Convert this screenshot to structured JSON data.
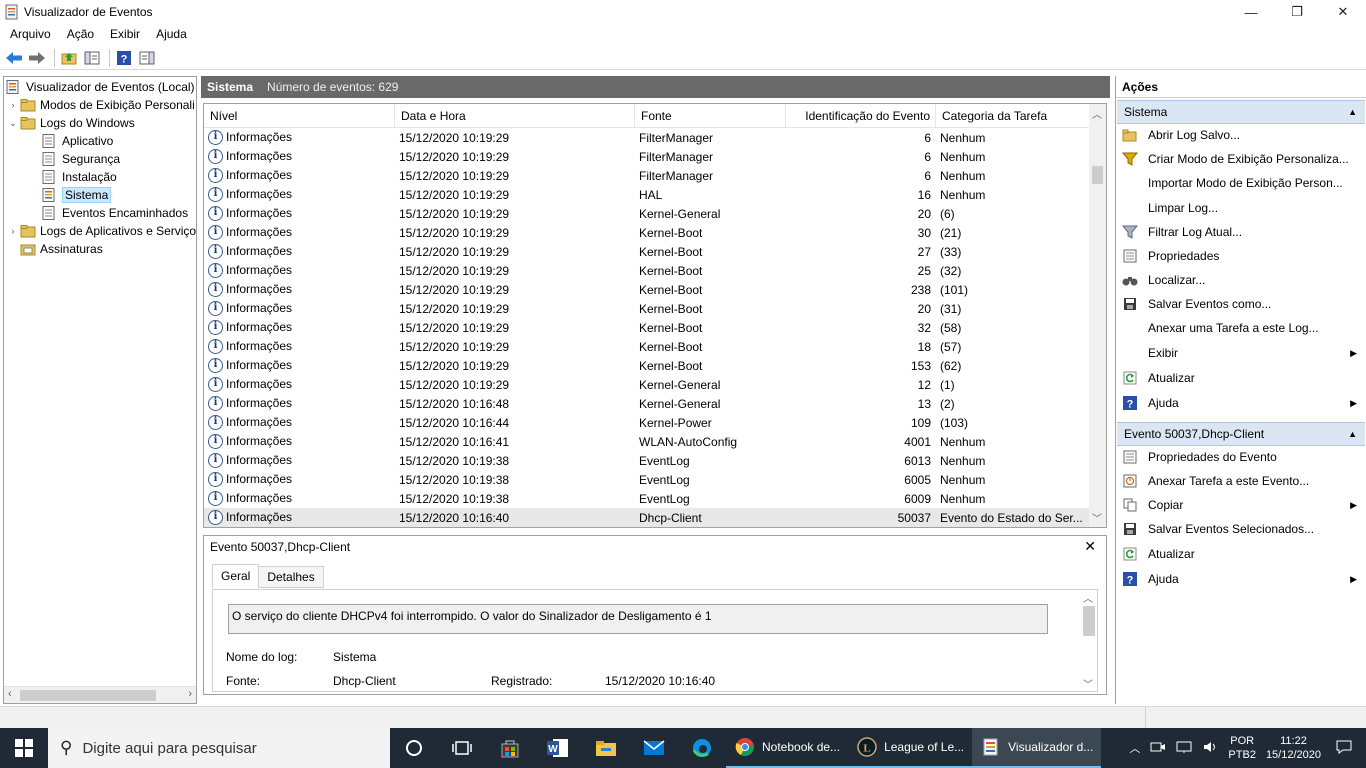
{
  "window": {
    "title": "Visualizador de Eventos",
    "min": "—",
    "max": "❐",
    "close": "✕"
  },
  "menu": [
    "Arquivo",
    "Ação",
    "Exibir",
    "Ajuda"
  ],
  "tree": {
    "root": "Visualizador de Eventos (Local)",
    "custom_views": "Modos de Exibição Personali",
    "windows_logs": "Logs do Windows",
    "app": "Aplicativo",
    "security": "Segurança",
    "setup": "Instalação",
    "system": "Sistema",
    "forwarded": "Eventos Encaminhados",
    "apps_services": "Logs de Aplicativos e Serviço",
    "subscriptions": "Assinaturas"
  },
  "center": {
    "title": "Sistema",
    "count": "Número de eventos: 629"
  },
  "grid": {
    "headers": [
      "Nível",
      "Data e Hora",
      "Fonte",
      "Identificação do Evento",
      "Categoria da Tarefa"
    ],
    "rows": [
      [
        "Informações",
        "15/12/2020 10:19:29",
        "FilterManager",
        "6",
        "Nenhum"
      ],
      [
        "Informações",
        "15/12/2020 10:19:29",
        "FilterManager",
        "6",
        "Nenhum"
      ],
      [
        "Informações",
        "15/12/2020 10:19:29",
        "FilterManager",
        "6",
        "Nenhum"
      ],
      [
        "Informações",
        "15/12/2020 10:19:29",
        "HAL",
        "16",
        "Nenhum"
      ],
      [
        "Informações",
        "15/12/2020 10:19:29",
        "Kernel-General",
        "20",
        "(6)"
      ],
      [
        "Informações",
        "15/12/2020 10:19:29",
        "Kernel-Boot",
        "30",
        "(21)"
      ],
      [
        "Informações",
        "15/12/2020 10:19:29",
        "Kernel-Boot",
        "27",
        "(33)"
      ],
      [
        "Informações",
        "15/12/2020 10:19:29",
        "Kernel-Boot",
        "25",
        "(32)"
      ],
      [
        "Informações",
        "15/12/2020 10:19:29",
        "Kernel-Boot",
        "238",
        "(101)"
      ],
      [
        "Informações",
        "15/12/2020 10:19:29",
        "Kernel-Boot",
        "20",
        "(31)"
      ],
      [
        "Informações",
        "15/12/2020 10:19:29",
        "Kernel-Boot",
        "32",
        "(58)"
      ],
      [
        "Informações",
        "15/12/2020 10:19:29",
        "Kernel-Boot",
        "18",
        "(57)"
      ],
      [
        "Informações",
        "15/12/2020 10:19:29",
        "Kernel-Boot",
        "153",
        "(62)"
      ],
      [
        "Informações",
        "15/12/2020 10:19:29",
        "Kernel-General",
        "12",
        "(1)"
      ],
      [
        "Informações",
        "15/12/2020 10:16:48",
        "Kernel-General",
        "13",
        "(2)"
      ],
      [
        "Informações",
        "15/12/2020 10:16:44",
        "Kernel-Power",
        "109",
        "(103)"
      ],
      [
        "Informações",
        "15/12/2020 10:16:41",
        "WLAN-AutoConfig",
        "4001",
        "Nenhum"
      ],
      [
        "Informações",
        "15/12/2020 10:19:38",
        "EventLog",
        "6013",
        "Nenhum"
      ],
      [
        "Informações",
        "15/12/2020 10:19:38",
        "EventLog",
        "6005",
        "Nenhum"
      ],
      [
        "Informações",
        "15/12/2020 10:19:38",
        "EventLog",
        "6009",
        "Nenhum"
      ],
      [
        "Informações",
        "15/12/2020 10:16:40",
        "Dhcp-Client",
        "50037",
        "Evento do Estado do Ser..."
      ]
    ],
    "selected_row": 20
  },
  "detail": {
    "title": "Evento 50037,Dhcp-Client",
    "tab_general": "Geral",
    "tab_details": "Detalhes",
    "description": "O serviço do cliente DHCPv4 foi interrompido. O valor do Sinalizador de Desligamento é 1",
    "log_name_label": "Nome do log:",
    "log_name_value": "Sistema",
    "source_label": "Fonte:",
    "source_value": "Dhcp-Client",
    "logged_label": "Registrado:",
    "logged_value": "15/12/2020 10:16:40"
  },
  "actions": {
    "header": "Ações",
    "section1": "Sistema",
    "items1": [
      "Abrir Log Salvo...",
      "Criar Modo de Exibição Personaliza...",
      "Importar Modo de Exibição Person...",
      "Limpar Log...",
      "Filtrar Log Atual...",
      "Propriedades",
      "Localizar...",
      "Salvar Eventos como...",
      "Anexar uma Tarefa a este Log...",
      "Exibir",
      "Atualizar",
      "Ajuda"
    ],
    "section2": "Evento 50037,Dhcp-Client",
    "items2": [
      "Propriedades do Evento",
      "Anexar Tarefa a este Evento...",
      "Copiar",
      "Salvar Eventos Selecionados...",
      "Atualizar",
      "Ajuda"
    ]
  },
  "taskbar": {
    "search_placeholder": "Digite aqui para pesquisar",
    "app1": "Notebook de...",
    "app2": "League of Le...",
    "app3": "Visualizador d...",
    "lang1": "POR",
    "lang2": "PTB2",
    "time": "11:22",
    "date": "15/12/2020"
  }
}
